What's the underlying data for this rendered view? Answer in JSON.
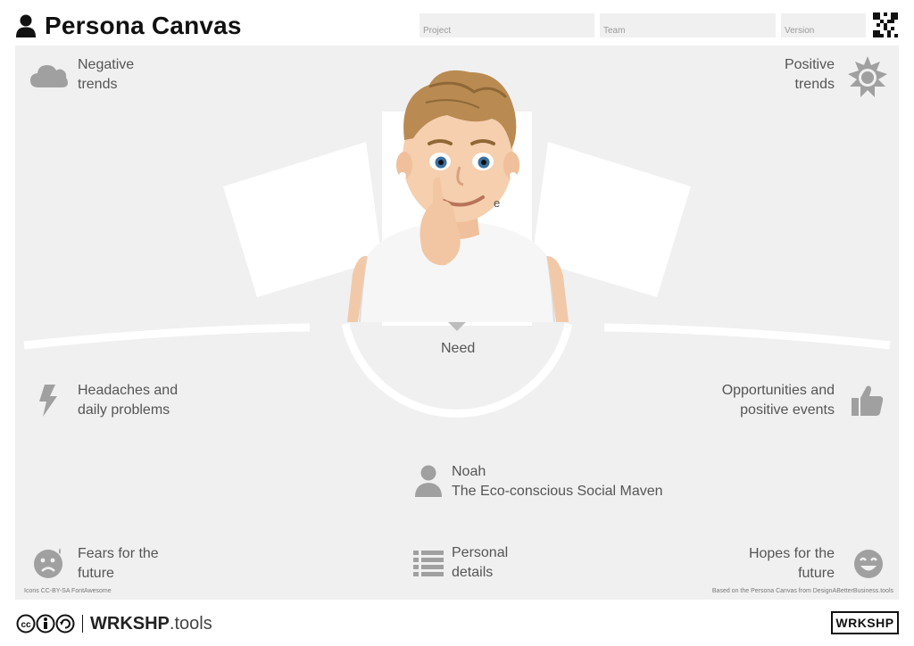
{
  "header": {
    "title": "Persona Canvas",
    "fields": [
      {
        "label": "Project"
      },
      {
        "label": "Team"
      },
      {
        "label": "Version"
      }
    ]
  },
  "canvas": {
    "negative_trends": [
      "Negative",
      "trends"
    ],
    "positive_trends": [
      "Positive",
      "trends"
    ],
    "need": "Need",
    "headaches": [
      "Headaches and",
      "daily problems"
    ],
    "opportunities": [
      "Opportunities and",
      "positive events"
    ],
    "persona": {
      "name": "Noah",
      "tagline": "The Eco-conscious Social Maven"
    },
    "fears": [
      "Fears for the",
      "future"
    ],
    "personal_details": [
      "Personal",
      "details"
    ],
    "hopes": [
      "Hopes for the",
      "future"
    ],
    "hidden_fragment": "e",
    "icons_credit": "Icons CC-BY-SA FontAwesome",
    "source_credit": "Based on the Persona Canvas from DesignABetterBusiness.tools"
  },
  "footer": {
    "brand_bold": "WRKSHP",
    "brand_light": ".tools",
    "badge": "WRKSHP"
  },
  "icons": {
    "user": "user-icon",
    "qr": "qr-code-icon",
    "cloud": "cloud-icon",
    "sun": "sun-icon",
    "bolt": "bolt-icon",
    "thumbs_up": "thumbs-up-icon",
    "person": "person-icon",
    "sad_face": "sad-face-icon",
    "list": "list-icon",
    "happy_face": "happy-face-icon",
    "cc_license": "creative-commons-icon"
  },
  "colors": {
    "panel": "#f0f0f0",
    "icon_gray": "#a0a0a0",
    "text": "#555555"
  }
}
